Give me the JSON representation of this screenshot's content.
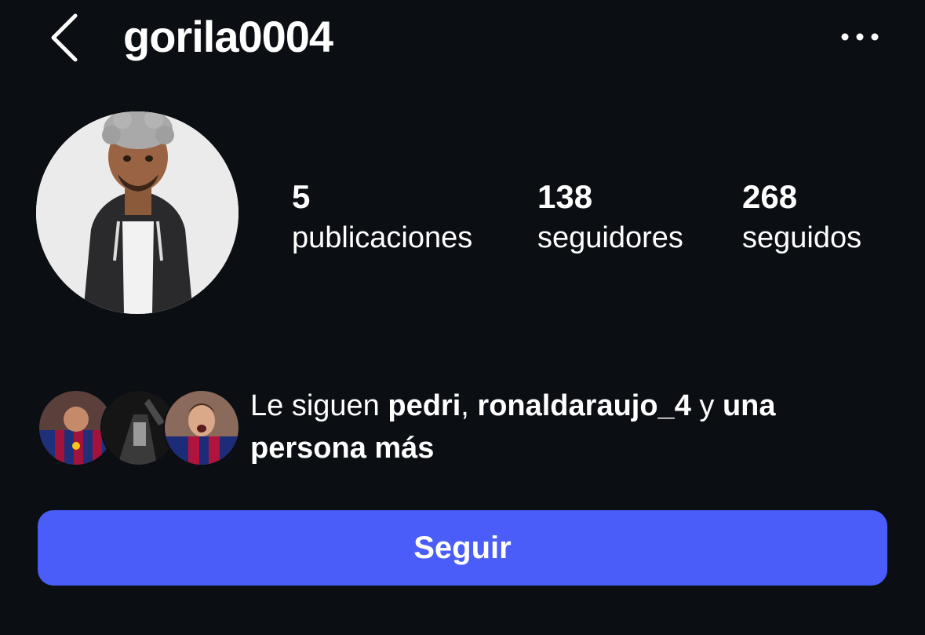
{
  "header": {
    "username": "gorila0004",
    "back_icon": "chevron-left-icon",
    "more_icon": "more-horizontal-icon"
  },
  "profile": {
    "avatar_icon": "avatar-3d-character",
    "stats": {
      "posts": {
        "value": "5",
        "label": "publicaciones"
      },
      "followers": {
        "value": "138",
        "label": "seguidores"
      },
      "following": {
        "value": "268",
        "label": "seguidos"
      }
    }
  },
  "mutual_followers": {
    "prefix": "Le siguen ",
    "user1": "pedri",
    "separator": ", ",
    "user2": "ronaldaraujo_4",
    "conjunction": " y ",
    "rest": "una persona más"
  },
  "actions": {
    "follow_label": "Seguir"
  },
  "colors": {
    "background": "#0b0e13",
    "text": "#ffffff",
    "button": "#4a5df9"
  }
}
